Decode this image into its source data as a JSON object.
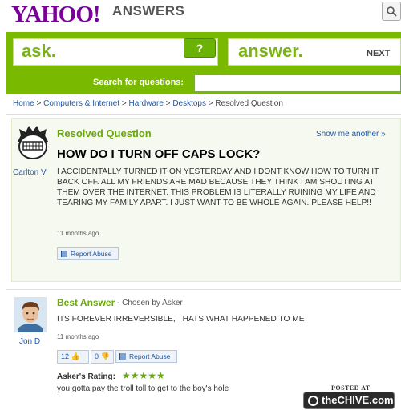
{
  "header": {
    "logo_text": "YAHOO!",
    "logo_answers": "ANSWERS"
  },
  "search_band": {
    "ask_label": "ask.",
    "smile_label": "?",
    "answer_label": "answer.",
    "next_label": "NEXT",
    "search_label": "Search for questions:",
    "search_value": ""
  },
  "breadcrumb": {
    "items": [
      "Home",
      "Computers & Internet",
      "Hardware",
      "Desktops"
    ],
    "separator": " > ",
    "current": "Resolved Question"
  },
  "question": {
    "status": "Resolved Question",
    "show_another": "Show me another »",
    "user": "Carlton V",
    "title": "HOW DO I TURN OFF CAPS LOCK?",
    "body": "I ACCIDENTALLY TURNED IT ON YESTERDAY AND I DONT KNOW HOW TO TURN IT BACK OFF. ALL MY FRIENDS ARE MAD BECAUSE THEY THINK I AM SHOUTING AT THEM OVER THE INTERNET. THIS PROBLEM IS LITERALLY RUINING MY LIFE AND TEARING MY FAMILY APART. I JUST WANT TO BE WHOLE AGAIN. PLEASE HELP!!",
    "time": "11 months ago",
    "report_label": "Report Abuse"
  },
  "answer": {
    "heading": "Best Answer",
    "chosen_by": "- Chosen by Asker",
    "user": "Jon D",
    "body": "ITS FOREVER IRREVERSIBLE, THATS WHAT HAPPENED TO ME",
    "time": "11 months ago",
    "thumbs_up": "12",
    "thumbs_down": "0",
    "report_label": "Report Abuse",
    "rating_label": "Asker's Rating:",
    "rating_stars": "★★★★★",
    "rating_value": 5,
    "rating_comment": "you gotta pay the troll toll to get to the boy's hole"
  },
  "watermark": {
    "posted_at": "POSTED AT",
    "site": "theCHIVE.com"
  },
  "colors": {
    "brand_purple": "#7b0099",
    "accent_green": "#79b900",
    "link_blue": "#1f57a8"
  }
}
